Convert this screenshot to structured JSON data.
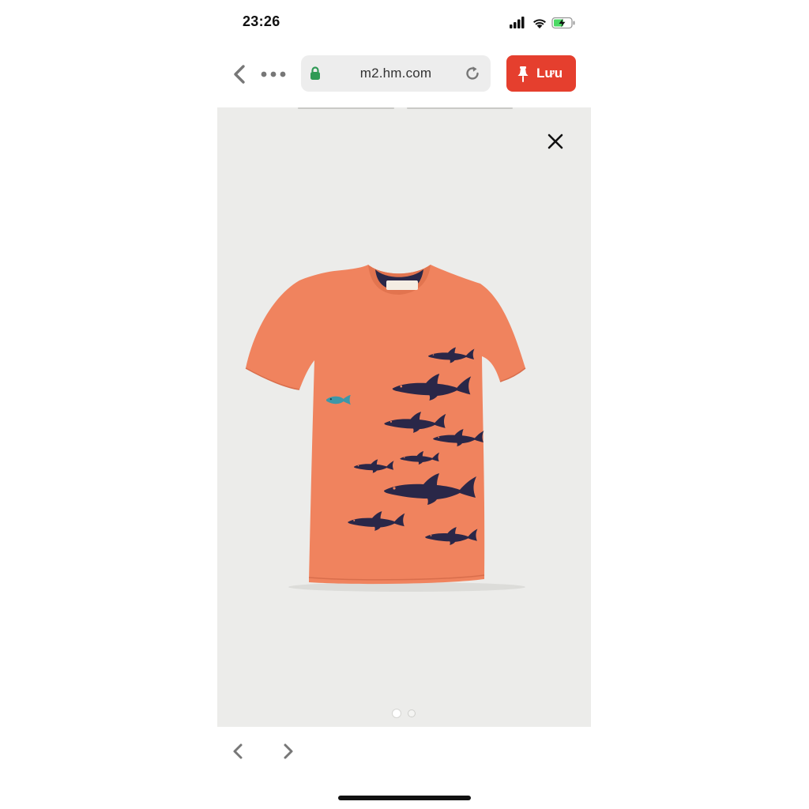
{
  "status_bar": {
    "time": "23:26",
    "icons": [
      "cellular-signal-icon",
      "wifi-icon",
      "battery-charging-icon"
    ]
  },
  "browser": {
    "url": "m2.hm.com",
    "save_label": "Lưu",
    "icons": [
      "back-chevron-icon",
      "more-dots-icon",
      "lock-icon",
      "reload-icon",
      "pin-icon"
    ]
  },
  "product_viewer": {
    "image": "orange t-shirt with navy shark print",
    "close_icon": "close-icon",
    "image_count": 2,
    "active_index": 1
  },
  "gallery_nav": {
    "icons": [
      "previous-chevron-icon",
      "next-chevron-icon"
    ]
  },
  "colors": {
    "save_button": "#e53f2e",
    "lock": "#2f9a55",
    "photo_background": "#ececea",
    "shirt": "#f0835e",
    "shark_print": "#2a2748",
    "small_fish": "#3e97a8"
  }
}
